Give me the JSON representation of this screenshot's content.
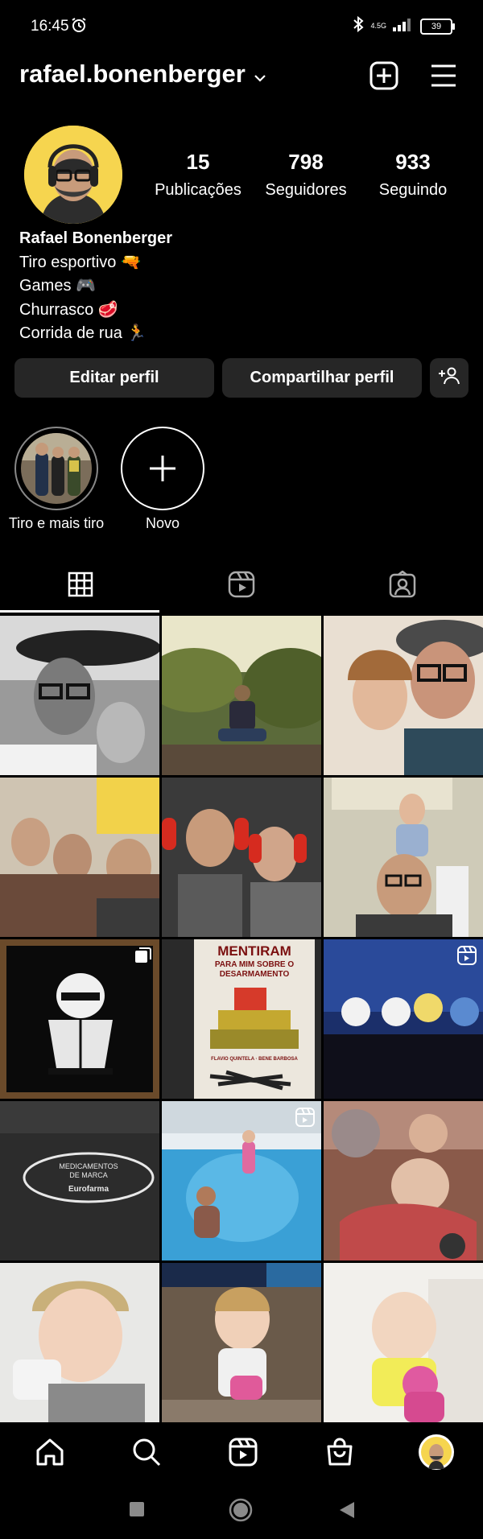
{
  "status": {
    "time": "16:45",
    "network": "4.5G",
    "battery": "39"
  },
  "header": {
    "username": "rafael.bonenberger"
  },
  "stats": [
    {
      "value": "15",
      "label": "Publicações"
    },
    {
      "value": "798",
      "label": "Seguidores"
    },
    {
      "value": "933",
      "label": "Seguindo"
    }
  ],
  "bio": {
    "name": "Rafael Bonenberger",
    "lines": [
      "Tiro esportivo 🔫",
      "Games 🎮",
      "Churrasco 🥩",
      "Corrida de rua 🏃"
    ]
  },
  "buttons": {
    "edit": "Editar perfil",
    "share": "Compartilhar perfil"
  },
  "highlights": [
    {
      "label": "Tiro e mais tiro"
    },
    {
      "label": "Novo"
    }
  ],
  "posts": [
    {
      "desc": "bw-selfie-with-daughter"
    },
    {
      "desc": "man-sitting-on-rails"
    },
    {
      "desc": "selfie-with-daughter"
    },
    {
      "desc": "family-on-sofa"
    },
    {
      "desc": "selfie-with-ear-protection"
    },
    {
      "desc": "daughter-on-shoulders"
    },
    {
      "desc": "pubg-art",
      "badge": "carousel"
    },
    {
      "desc": "book-cover",
      "title_lines": [
        "MENTIRAM",
        "PARA MIM SOBRE O",
        "DESARMAMENTO"
      ],
      "authors": "FLAVIO QUINTELA · BENE BARBOSA"
    },
    {
      "desc": "stage-show",
      "badge": "reel"
    },
    {
      "desc": "eurofarma-bag",
      "bag_text_1": "MEDICAMENTOS",
      "bag_text_2": "DE MARCA",
      "bag_brand": "Eurofarma"
    },
    {
      "desc": "pool",
      "badge": "reel"
    },
    {
      "desc": "baby-in-toy-car"
    },
    {
      "desc": "child-with-mug"
    },
    {
      "desc": "toddler-standing"
    },
    {
      "desc": "baby-smiling"
    }
  ]
}
